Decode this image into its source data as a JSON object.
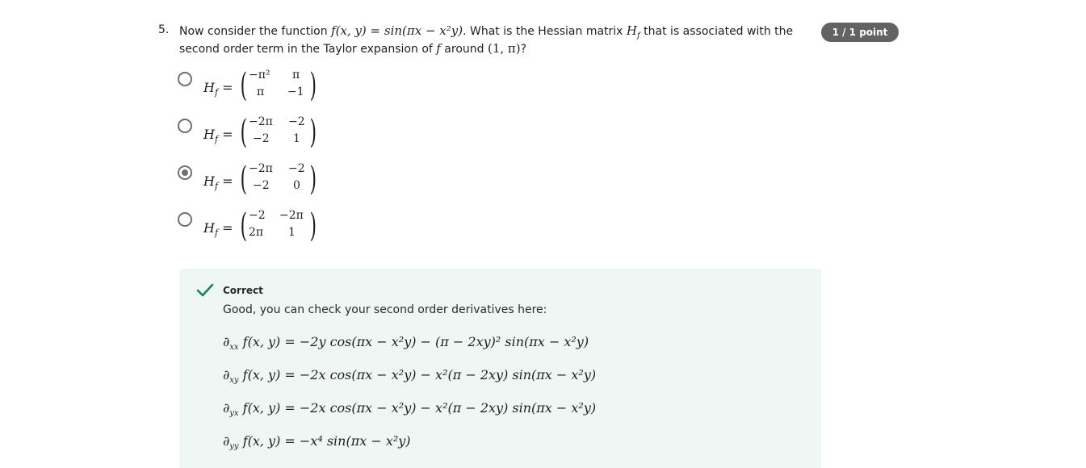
{
  "question": {
    "number": "5.",
    "text_prefix": "Now consider the function",
    "function_def": "f(x, y) = sin(πx − x²y)",
    "text_middle": ". What is the Hessian matrix",
    "hessian_symbol": "H",
    "hessian_sub": "f",
    "text_suffix": " that is associated with the second order term in the Taylor expansion of",
    "f_symbol": "f",
    "text_around": "around",
    "point": "(1, π)",
    "question_mark": "?",
    "points_badge": "1 / 1 point"
  },
  "options": [
    {
      "label_main": "H",
      "label_sub": "f",
      "equals": "=",
      "a11": "−π²",
      "a12": "π",
      "a21": "π",
      "a22": "−1",
      "selected": false
    },
    {
      "label_main": "H",
      "label_sub": "f",
      "equals": "=",
      "a11": "−2π",
      "a12": "−2",
      "a21": "−2",
      "a22": "1",
      "selected": false
    },
    {
      "label_main": "H",
      "label_sub": "f",
      "equals": "=",
      "a11": "−2π",
      "a12": "−2",
      "a21": "−2",
      "a22": "0",
      "selected": true
    },
    {
      "label_main": "H",
      "label_sub": "f",
      "equals": "=",
      "a11": "−2",
      "a12": "−2π",
      "a21": "2π",
      "a22": "1",
      "selected": false
    }
  ],
  "feedback": {
    "status": "Correct",
    "message": "Good, you can check your second order derivatives here:",
    "derivatives": [
      {
        "symbol": "∂",
        "sub": "xx",
        "expr": "f(x, y) = −2y cos(πx − x²y) − (π − 2xy)² sin(πx − x²y)"
      },
      {
        "symbol": "∂",
        "sub": "xy",
        "expr": "f(x, y) = −2x cos(πx − x²y) − x²(π − 2xy) sin(πx − x²y)"
      },
      {
        "symbol": "∂",
        "sub": "yx",
        "expr": "f(x, y) = −2x cos(πx − x²y) − x²(π − 2xy) sin(πx − x²y)"
      },
      {
        "symbol": "∂",
        "sub": "yy",
        "expr": "f(x, y) = −x⁴ sin(πx − x²y)"
      }
    ],
    "check_color": "#1a7f5a"
  },
  "colors": {
    "badge_bg": "#636363",
    "feedback_bg": "#eef7f3"
  }
}
